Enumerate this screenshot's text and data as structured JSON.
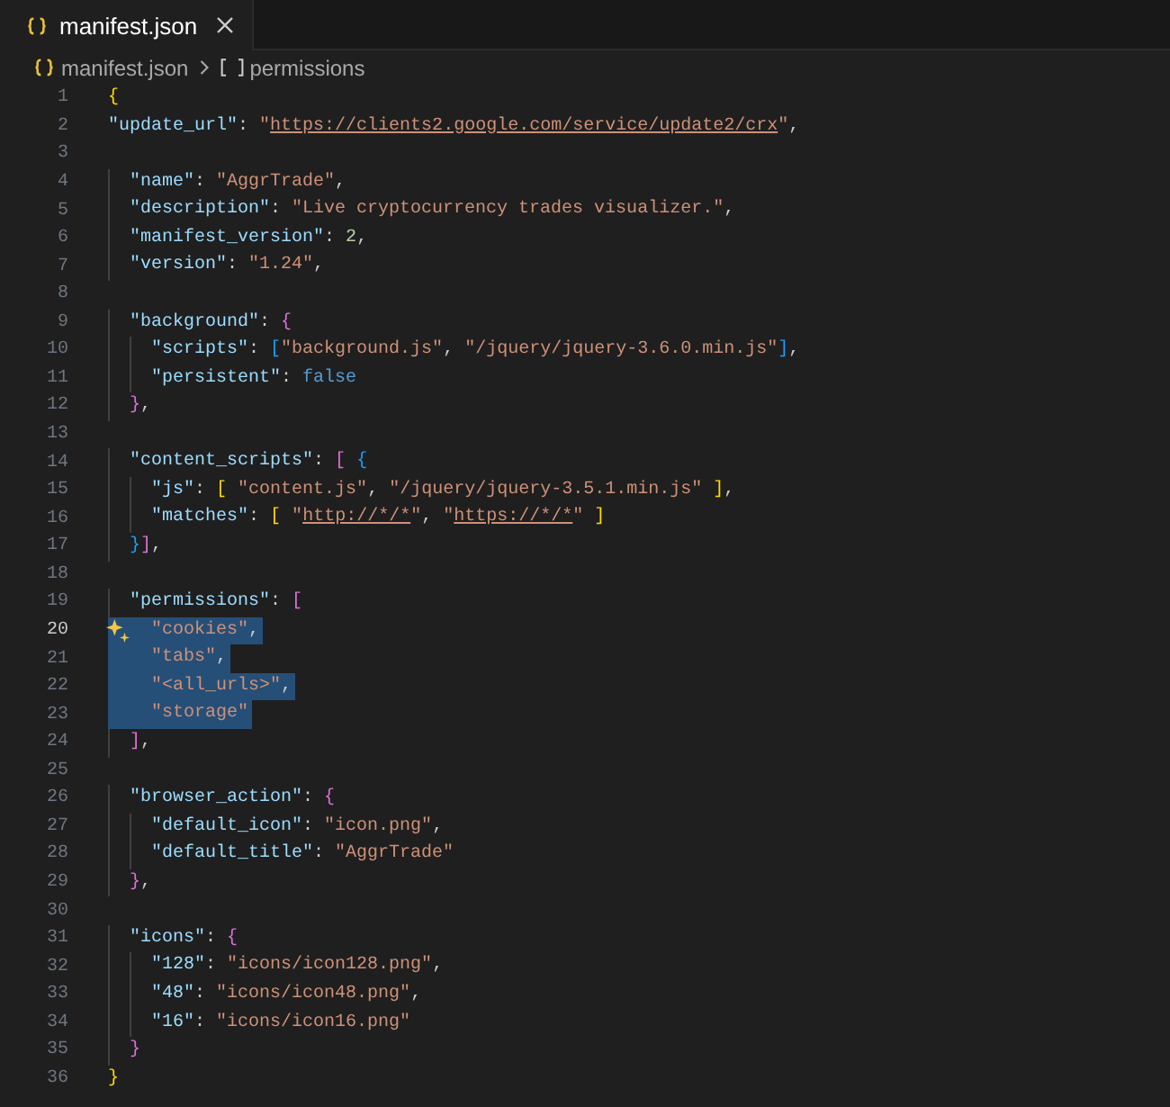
{
  "tabs": [
    {
      "label": "manifest.json",
      "selected": true
    }
  ],
  "breadcrumb": [
    "manifest.json",
    "permissions"
  ],
  "lines": [
    {
      "n": "1",
      "selected": false,
      "current": false,
      "tokens": [
        {
          "kind": "bracket1",
          "text": "{"
        }
      ]
    },
    {
      "n": "2",
      "selected": false,
      "current": false,
      "tokens": [
        {
          "kind": "key",
          "text": "\"update_url\""
        },
        {
          "kind": "punct",
          "text": ": "
        },
        {
          "kind": "string",
          "text": "\""
        },
        {
          "kind": "link",
          "text": "https://clients2.google.com/service/update2/crx"
        },
        {
          "kind": "string",
          "text": "\""
        },
        {
          "kind": "punct",
          "text": ","
        }
      ]
    },
    {
      "n": "3",
      "selected": false,
      "current": false
    },
    {
      "n": "4",
      "selected": false,
      "current": false,
      "tokens": [
        {
          "kind": "key",
          "text": "  \"name\""
        },
        {
          "kind": "punct",
          "text": ": "
        },
        {
          "kind": "string",
          "text": "\"AggrTrade\""
        },
        {
          "kind": "punct",
          "text": ","
        }
      ]
    },
    {
      "n": "5",
      "selected": false,
      "current": false,
      "tokens": [
        {
          "kind": "key",
          "text": "  \"description\""
        },
        {
          "kind": "punct",
          "text": ": "
        },
        {
          "kind": "string",
          "text": "\"Live cryptocurrency trades visualizer.\""
        },
        {
          "kind": "punct",
          "text": ","
        }
      ]
    },
    {
      "n": "6",
      "selected": false,
      "current": false,
      "tokens": [
        {
          "kind": "key",
          "text": "  \"manifest_version\""
        },
        {
          "kind": "punct",
          "text": ": "
        },
        {
          "kind": "number",
          "text": "2"
        },
        {
          "kind": "punct",
          "text": ","
        }
      ]
    },
    {
      "n": "7",
      "selected": false,
      "current": false,
      "tokens": [
        {
          "kind": "key",
          "text": "  \"version\""
        },
        {
          "kind": "punct",
          "text": ": "
        },
        {
          "kind": "string",
          "text": "\"1.24\""
        },
        {
          "kind": "punct",
          "text": ","
        }
      ]
    },
    {
      "n": "8",
      "selected": false,
      "current": false
    },
    {
      "n": "9",
      "selected": false,
      "current": false,
      "tokens": [
        {
          "kind": "key",
          "text": "  \"background\""
        },
        {
          "kind": "punct",
          "text": ": "
        },
        {
          "kind": "bracket2",
          "text": "{"
        }
      ]
    },
    {
      "n": "10",
      "selected": false,
      "current": false,
      "tokens": [
        {
          "kind": "key",
          "text": "    \"scripts\""
        },
        {
          "kind": "punct",
          "text": ": "
        },
        {
          "kind": "bracket3",
          "text": "["
        },
        {
          "kind": "string",
          "text": "\"background.js\""
        },
        {
          "kind": "punct",
          "text": ", "
        },
        {
          "kind": "string",
          "text": "\"/jquery/jquery-3.6.0.min.js\""
        },
        {
          "kind": "bracket3",
          "text": "]"
        },
        {
          "kind": "punct",
          "text": ","
        }
      ]
    },
    {
      "n": "11",
      "selected": false,
      "current": false,
      "tokens": [
        {
          "kind": "key",
          "text": "    \"persistent\""
        },
        {
          "kind": "punct",
          "text": ": "
        },
        {
          "kind": "keyword",
          "text": "false"
        }
      ]
    },
    {
      "n": "12",
      "selected": false,
      "current": false,
      "tokens": [
        {
          "kind": "bracket2",
          "text": "  }"
        },
        {
          "kind": "punct",
          "text": ","
        }
      ]
    },
    {
      "n": "13",
      "selected": false,
      "current": false
    },
    {
      "n": "14",
      "selected": false,
      "current": false,
      "tokens": [
        {
          "kind": "key",
          "text": "  \"content_scripts\""
        },
        {
          "kind": "punct",
          "text": ": "
        },
        {
          "kind": "bracket2",
          "text": "["
        },
        {
          "kind": "bracket3",
          "text": " {"
        }
      ]
    },
    {
      "n": "15",
      "selected": false,
      "current": false,
      "tokens": [
        {
          "kind": "key",
          "text": "    \"js\""
        },
        {
          "kind": "punct",
          "text": ": "
        },
        {
          "kind": "bracket1",
          "text": "["
        },
        {
          "kind": "string",
          "text": " \"content.js\""
        },
        {
          "kind": "punct",
          "text": ", "
        },
        {
          "kind": "string",
          "text": "\"/jquery/jquery-3.5.1.min.js\""
        },
        {
          "kind": "bracket1",
          "text": " ]"
        },
        {
          "kind": "punct",
          "text": ","
        }
      ]
    },
    {
      "n": "16",
      "selected": false,
      "current": false,
      "tokens": [
        {
          "kind": "key",
          "text": "    \"matches\""
        },
        {
          "kind": "punct",
          "text": ": "
        },
        {
          "kind": "bracket1",
          "text": "["
        },
        {
          "kind": "string",
          "text": " \""
        },
        {
          "kind": "link",
          "text": "http://*/*"
        },
        {
          "kind": "string",
          "text": "\""
        },
        {
          "kind": "punct",
          "text": ", "
        },
        {
          "kind": "string",
          "text": "\""
        },
        {
          "kind": "link",
          "text": "https://*/*"
        },
        {
          "kind": "string",
          "text": "\""
        },
        {
          "kind": "bracket1",
          "text": " ]"
        }
      ]
    },
    {
      "n": "17",
      "selected": false,
      "current": false,
      "tokens": [
        {
          "kind": "bracket3",
          "text": "  }"
        },
        {
          "kind": "bracket2",
          "text": "]"
        },
        {
          "kind": "punct",
          "text": ","
        }
      ]
    },
    {
      "n": "18",
      "selected": false,
      "current": false
    },
    {
      "n": "19",
      "selected": false,
      "current": false,
      "tokens": [
        {
          "kind": "key",
          "text": "  \"permissions\""
        },
        {
          "kind": "punct",
          "text": ": "
        },
        {
          "kind": "bracket2",
          "text": "["
        }
      ]
    },
    {
      "n": "20",
      "selected": true,
      "current": true,
      "tokens": [
        {
          "kind": "string",
          "text": "    \"cookies\""
        },
        {
          "kind": "punct",
          "text": ","
        }
      ]
    },
    {
      "n": "21",
      "selected": true,
      "current": false,
      "tokens": [
        {
          "kind": "string",
          "text": "    \"tabs\""
        },
        {
          "kind": "punct",
          "text": ","
        }
      ]
    },
    {
      "n": "22",
      "selected": true,
      "current": false,
      "tokens": [
        {
          "kind": "string",
          "text": "    \"<all_urls>\""
        },
        {
          "kind": "punct",
          "text": ","
        }
      ]
    },
    {
      "n": "23",
      "selected": true,
      "current": false,
      "tokens": [
        {
          "kind": "string",
          "text": "    \"storage\""
        }
      ]
    },
    {
      "n": "24",
      "selected": false,
      "current": false,
      "tokens": [
        {
          "kind": "bracket2",
          "text": "  ]"
        },
        {
          "kind": "punct",
          "text": ","
        }
      ]
    },
    {
      "n": "25",
      "selected": false,
      "current": false
    },
    {
      "n": "26",
      "selected": false,
      "current": false,
      "tokens": [
        {
          "kind": "key",
          "text": "  \"browser_action\""
        },
        {
          "kind": "punct",
          "text": ": "
        },
        {
          "kind": "bracket2",
          "text": "{"
        }
      ]
    },
    {
      "n": "27",
      "selected": false,
      "current": false,
      "tokens": [
        {
          "kind": "key",
          "text": "    \"default_icon\""
        },
        {
          "kind": "punct",
          "text": ": "
        },
        {
          "kind": "string",
          "text": "\"icon.png\""
        },
        {
          "kind": "punct",
          "text": ","
        }
      ]
    },
    {
      "n": "28",
      "selected": false,
      "current": false,
      "tokens": [
        {
          "kind": "key",
          "text": "    \"default_title\""
        },
        {
          "kind": "punct",
          "text": ": "
        },
        {
          "kind": "string",
          "text": "\"AggrTrade\""
        }
      ]
    },
    {
      "n": "29",
      "selected": false,
      "current": false,
      "tokens": [
        {
          "kind": "bracket2",
          "text": "  }"
        },
        {
          "kind": "punct",
          "text": ","
        }
      ]
    },
    {
      "n": "30",
      "selected": false,
      "current": false
    },
    {
      "n": "31",
      "selected": false,
      "current": false,
      "tokens": [
        {
          "kind": "key",
          "text": "  \"icons\""
        },
        {
          "kind": "punct",
          "text": ": "
        },
        {
          "kind": "bracket2",
          "text": "{"
        }
      ]
    },
    {
      "n": "32",
      "selected": false,
      "current": false,
      "tokens": [
        {
          "kind": "key",
          "text": "    \"128\""
        },
        {
          "kind": "punct",
          "text": ": "
        },
        {
          "kind": "string",
          "text": "\"icons/icon128.png\""
        },
        {
          "kind": "punct",
          "text": ","
        }
      ]
    },
    {
      "n": "33",
      "selected": false,
      "current": false,
      "tokens": [
        {
          "kind": "key",
          "text": "    \"48\""
        },
        {
          "kind": "punct",
          "text": ": "
        },
        {
          "kind": "string",
          "text": "\"icons/icon48.png\""
        },
        {
          "kind": "punct",
          "text": ","
        }
      ]
    },
    {
      "n": "34",
      "selected": false,
      "current": false,
      "tokens": [
        {
          "kind": "key",
          "text": "    \"16\""
        },
        {
          "kind": "punct",
          "text": ": "
        },
        {
          "kind": "string",
          "text": "\"icons/icon16.png\""
        }
      ]
    },
    {
      "n": "35",
      "selected": false,
      "current": false,
      "tokens": [
        {
          "kind": "bracket2",
          "text": "  }"
        }
      ]
    },
    {
      "n": "36",
      "selected": false,
      "current": false,
      "tokens": [
        {
          "kind": "bracket1",
          "text": "}"
        }
      ]
    }
  ]
}
